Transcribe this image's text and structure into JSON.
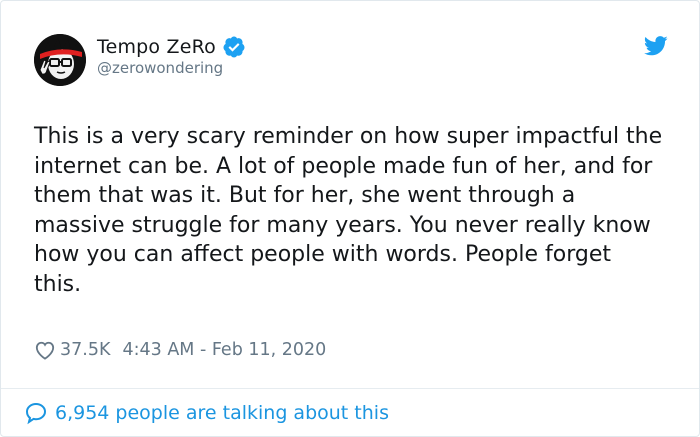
{
  "tweet": {
    "display_name": "Tempo ZeRo",
    "handle": "@zerowondering",
    "text": "This is a very scary reminder on how super impactful the internet can be. A lot of people made fun of her, and for them that was it. But for her, she went through a massive struggle for many years. You never really know how you can affect people with words. People forget this.",
    "likes": "37.5K",
    "timestamp": "4:43 AM - Feb 11, 2020",
    "talking": "6,954 people are talking about this"
  },
  "icons": {
    "verified": "verified-badge-icon",
    "brand": "twitter-bird-icon",
    "like": "heart-icon",
    "talking": "speech-bubble-icon"
  },
  "colors": {
    "brand_blue": "#1da1f2",
    "link_blue": "#1b95e0",
    "secondary_text": "#657786",
    "primary_text": "#14171a",
    "avatar_accent": "#e02020"
  }
}
